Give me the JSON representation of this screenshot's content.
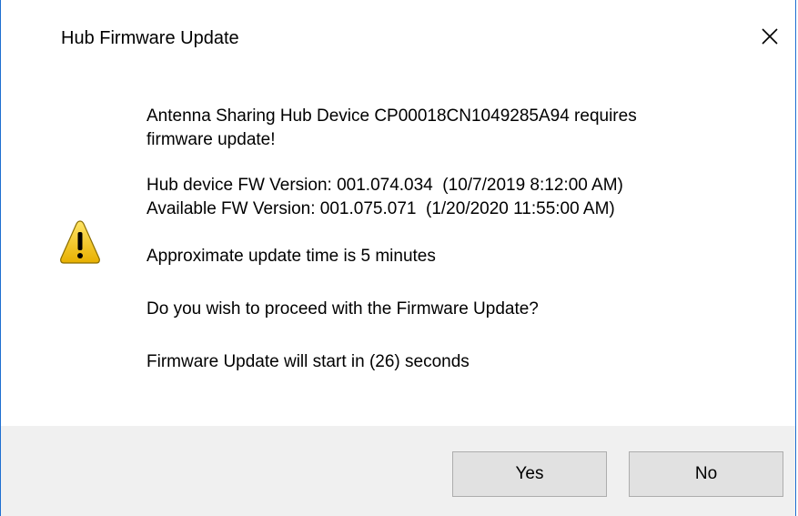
{
  "dialog": {
    "title": "Hub Firmware Update",
    "close_icon": "close-icon",
    "warning_icon": "warning-icon",
    "message_line1": "Antenna Sharing Hub Device CP00018CN1049285A94 requires",
    "message_line2": "firmware update!",
    "hub_version": "Hub device FW Version: 001.074.034  (10/7/2019 8:12:00 AM)",
    "available_version": "Available FW Version: 001.075.071  (1/20/2020 11:55:00 AM)",
    "update_time": "Approximate update time is 5 minutes",
    "question": "Do you wish to proceed with the Firmware Update?",
    "countdown": "Firmware Update will start in (26) seconds",
    "yes_label": "Yes",
    "no_label": "No"
  },
  "colors": {
    "window_border": "#1e6fd1",
    "footer_bg": "#f0f0f0",
    "button_bg": "#e1e1e1",
    "warning_yellow": "#f5c400"
  }
}
